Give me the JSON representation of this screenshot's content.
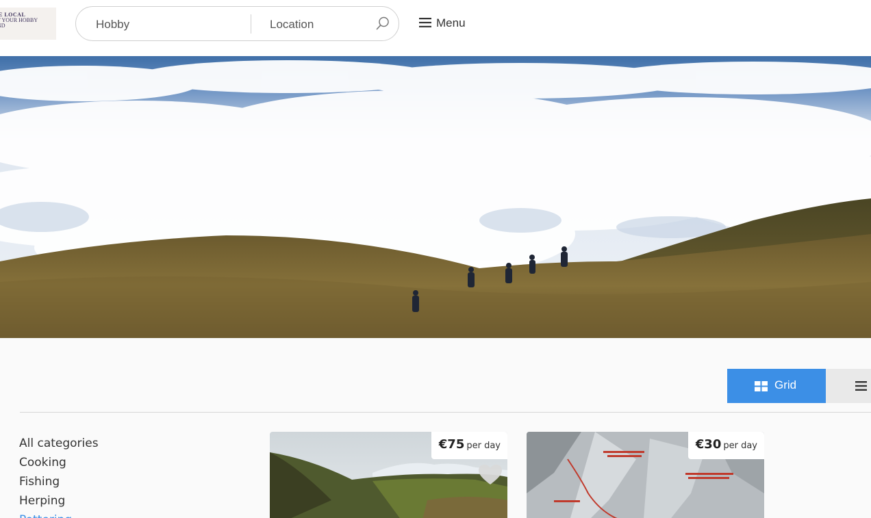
{
  "header": {
    "logo": {
      "line1": "E LOCAL",
      "line2": "T YOUR HOBBY",
      "line3": "ND"
    },
    "search": {
      "hobby_placeholder": "Hobby",
      "location_placeholder": "Location",
      "icon": "search-icon"
    },
    "menu_label": "Menu",
    "menu_icon": "hamburger-icon"
  },
  "hero": {
    "description_icon": "hero-image"
  },
  "view_toggle": {
    "grid_label": "Grid",
    "grid_icon": "grid-icon",
    "list_icon": "list-icon",
    "active": "Grid",
    "accent_color": "#3c8fe6"
  },
  "sidebar": {
    "categories": [
      "All categories",
      "Cooking",
      "Fishing",
      "Herping",
      "Pottering"
    ],
    "active_category": "Pottering"
  },
  "listings": [
    {
      "price": "€75",
      "unit": "per day"
    },
    {
      "price": "€30",
      "unit": "per day"
    }
  ]
}
